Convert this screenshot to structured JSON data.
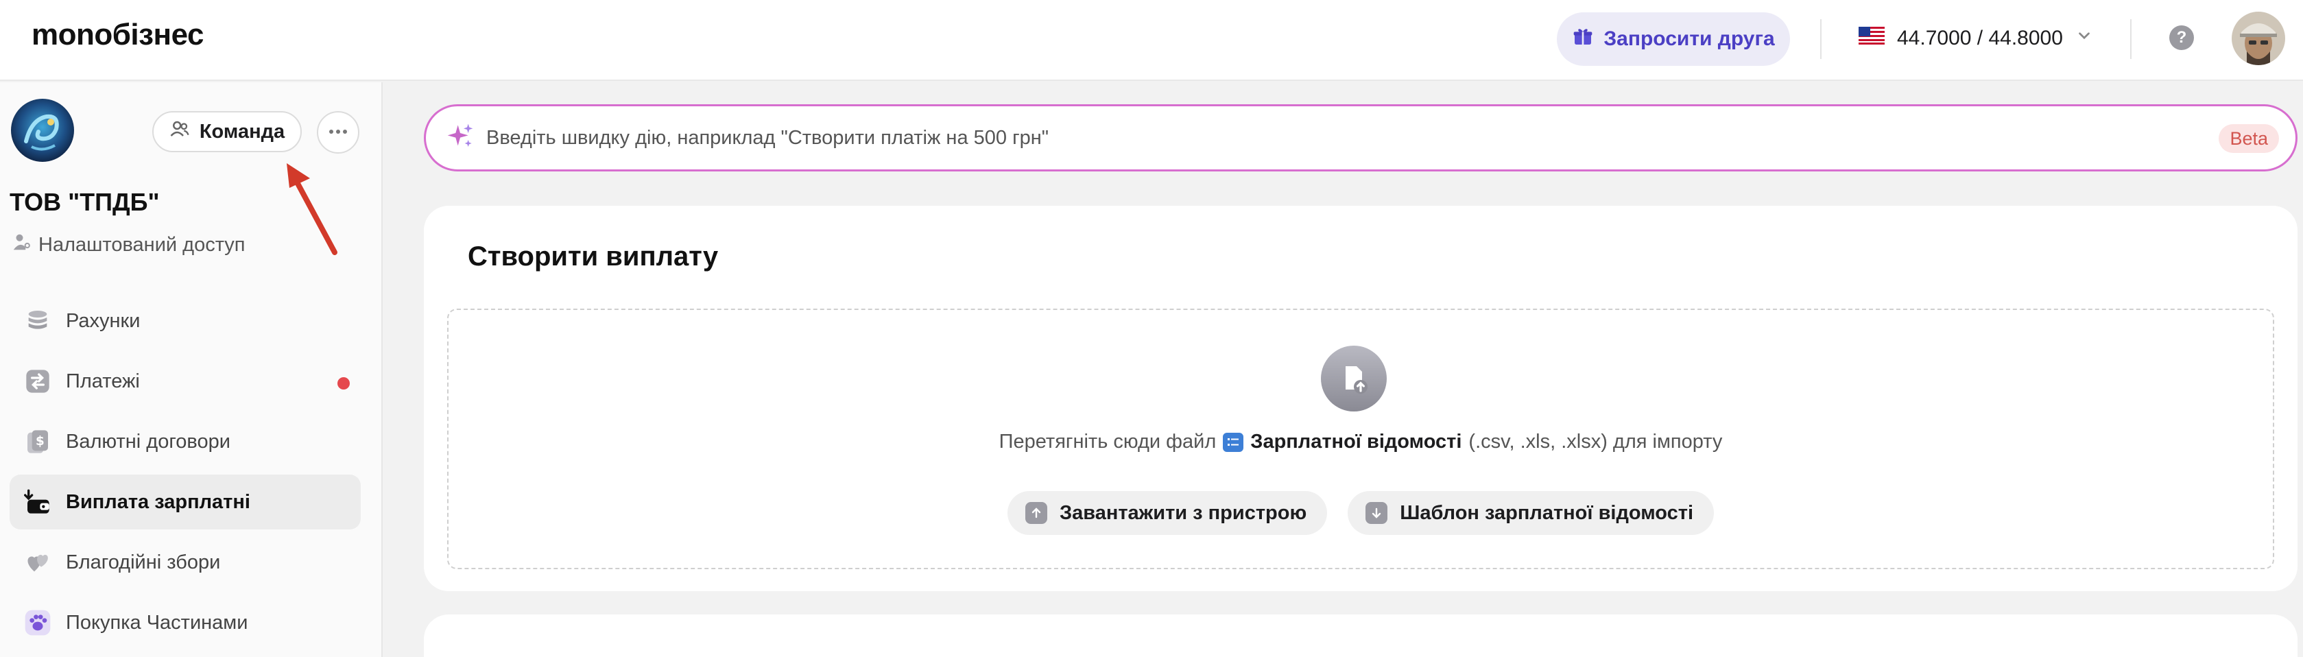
{
  "header": {
    "logo": "monoбізнес",
    "invite_label": "Запросити друга",
    "currency_rate": "44.7000 / 44.8000",
    "help_symbol": "?"
  },
  "sidebar": {
    "team_label": "Команда",
    "company_name": "ТОВ \"ТПДБ\"",
    "access_label": "Налаштований доступ",
    "items": [
      {
        "label": "Рахунки",
        "icon": "stack-coins-icon"
      },
      {
        "label": "Платежі",
        "icon": "transfer-arrows-icon",
        "has_notification": true
      },
      {
        "label": "Валютні договори",
        "icon": "dollar-document-icon"
      },
      {
        "label": "Виплата зарплатні",
        "icon": "wallet-download-icon",
        "active": true
      },
      {
        "label": "Благодійні збори",
        "icon": "hearts-icon"
      },
      {
        "label": "Покупка Частинами",
        "icon": "paw-icon"
      }
    ]
  },
  "quick_action": {
    "placeholder": "Введіть швидку дію, наприклад \"Створити платіж на 500 грн\"",
    "badge": "Beta"
  },
  "payout": {
    "title": "Створити виплату",
    "drop_prefix": "Перетягніть сюди файл",
    "drop_link": "Зарплатної відомості",
    "drop_suffix": "(.csv, .xls, .xlsx) для імпорту",
    "upload_label": "Завантажити з пристрою",
    "template_label": "Шаблон зарплатної відомості"
  },
  "colors": {
    "accent": "#4b3fc4",
    "quick_border": "#d76ecf",
    "notification": "#e5484d",
    "annotation_arrow": "#d23a2a"
  }
}
